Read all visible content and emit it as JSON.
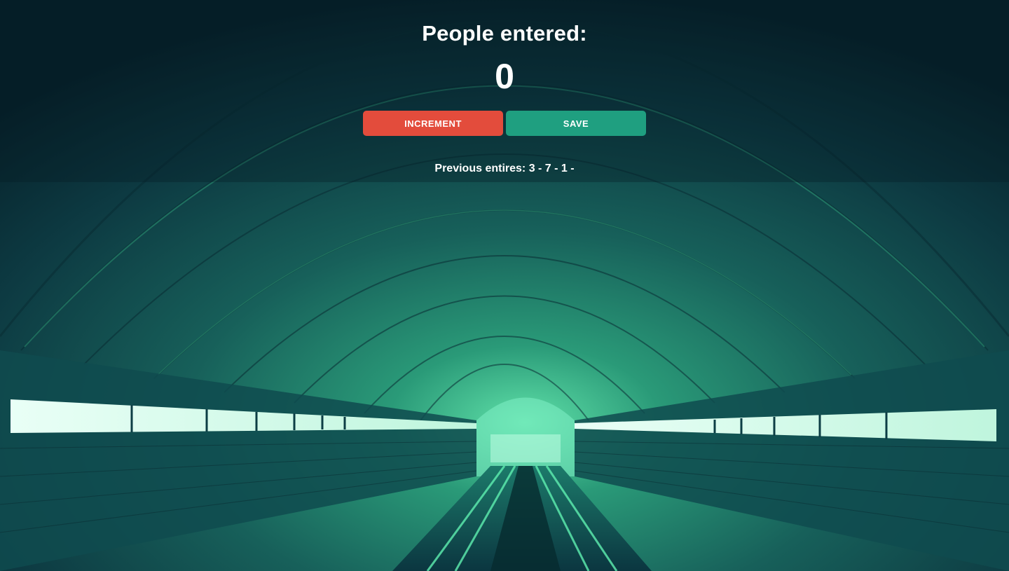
{
  "counter": {
    "heading": "People entered:",
    "count": "0"
  },
  "buttons": {
    "increment_label": "INCREMENT",
    "save_label": "SAVE"
  },
  "history": {
    "label": "Previous entires: ",
    "entries_text": "3 - 7 - 1 -"
  },
  "colors": {
    "increment_bg": "#e34c3c",
    "save_bg": "#1f9f80",
    "text": "#ffffff"
  }
}
